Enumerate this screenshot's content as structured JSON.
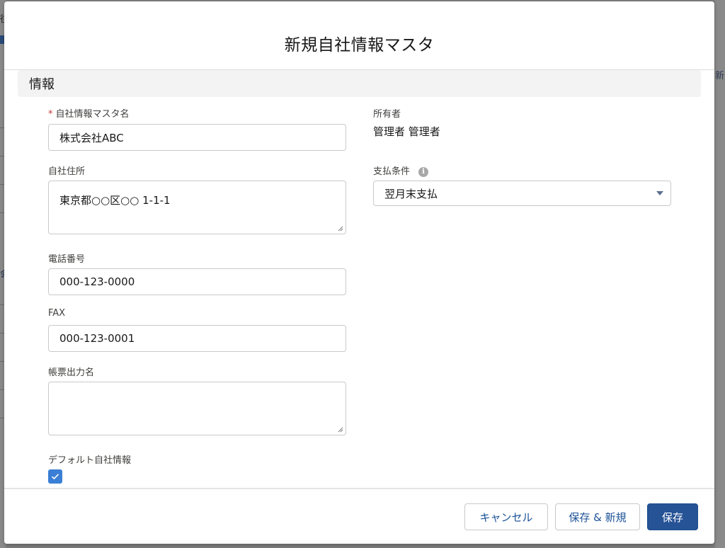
{
  "background": {
    "left_top_text": "往",
    "left_mid_text": "会",
    "right_text": "新"
  },
  "modal": {
    "title": "新規自社情報マスタ",
    "section_title": "情報"
  },
  "fields": {
    "company_name": {
      "label": "自社情報マスタ名",
      "required_mark": "*",
      "value": "株式会社ABC"
    },
    "address": {
      "label": "自社住所",
      "value": "東京都○○区○○ 1-1-1"
    },
    "phone": {
      "label": "電話番号",
      "value": "000-123-0000"
    },
    "fax": {
      "label": "FAX",
      "value": "000-123-0001"
    },
    "document_name": {
      "label": "帳票出力名",
      "value": ""
    },
    "default_flag": {
      "label": "デフォルト自社情報",
      "checked": true
    },
    "owner": {
      "label": "所有者",
      "value": "管理者 管理者"
    },
    "payment_terms": {
      "label": "支払条件",
      "value": "翌月末支払",
      "info_icon": "info-icon"
    }
  },
  "footer": {
    "cancel_label": "キャンセル",
    "save_new_label": "保存 & 新規",
    "save_label": "保存"
  },
  "colors": {
    "brand": "#265296",
    "required": "#c23934",
    "checkbox": "#3a7fd5"
  }
}
